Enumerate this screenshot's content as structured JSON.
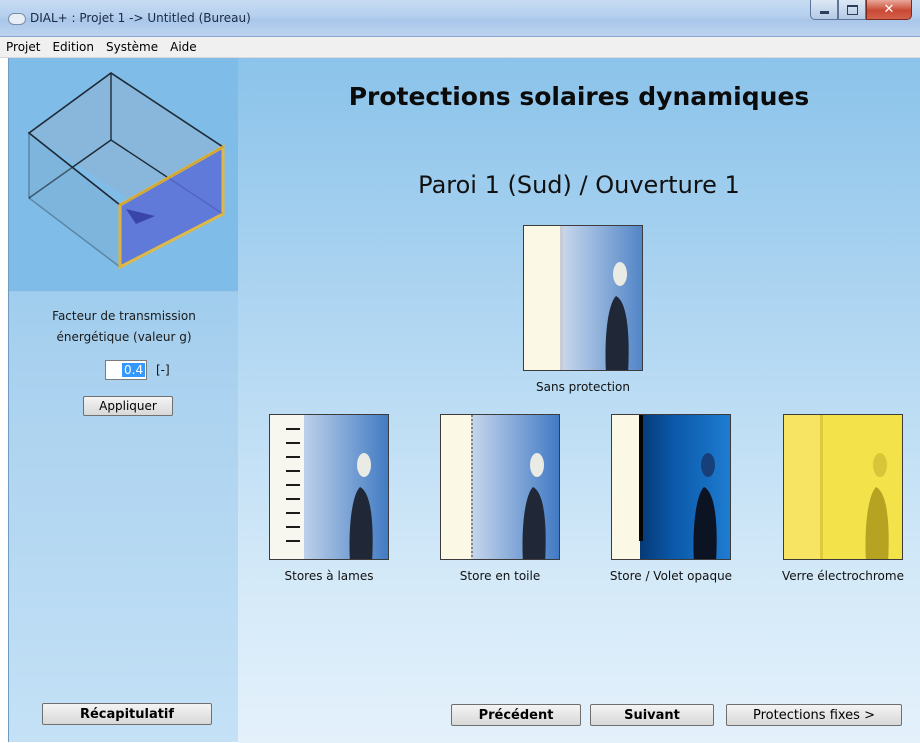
{
  "window": {
    "title": "DIAL+ : Projet 1 -> Untitled (Bureau)"
  },
  "menu": [
    "Projet",
    "Edition",
    "Système",
    "Aide"
  ],
  "sidebar": {
    "gfactor_label_line1": "Facteur de transmission",
    "gfactor_label_line2": "énergétique (valeur g)",
    "gfactor_value": "0.4",
    "gfactor_unit": "[-]",
    "apply_label": "Appliquer",
    "recap_label": "Récapitulatif"
  },
  "main": {
    "title": "Protections solaires dynamiques",
    "subtitle": "Paroi 1 (Sud) / Ouverture 1",
    "options": [
      {
        "label": "Sans protection",
        "icon": "no-protection-icon"
      },
      {
        "label": "Stores à lames",
        "icon": "slat-blinds-icon"
      },
      {
        "label": "Store en toile",
        "icon": "fabric-blind-icon"
      },
      {
        "label": "Store / Volet opaque",
        "icon": "opaque-shutter-icon"
      },
      {
        "label": "Verre électrochrome",
        "icon": "electrochromic-glass-icon"
      }
    ],
    "prev_label": "Précédent",
    "next_label": "Suivant",
    "fixed_label": "Protections fixes >"
  },
  "colors": {
    "sidebar_top": "#7fbde8",
    "main_top": "#8bc3ea",
    "wall_highlight": "#f0b92a",
    "window_fill": "#5b6fd8",
    "electrochrome": "#f4e24a"
  }
}
